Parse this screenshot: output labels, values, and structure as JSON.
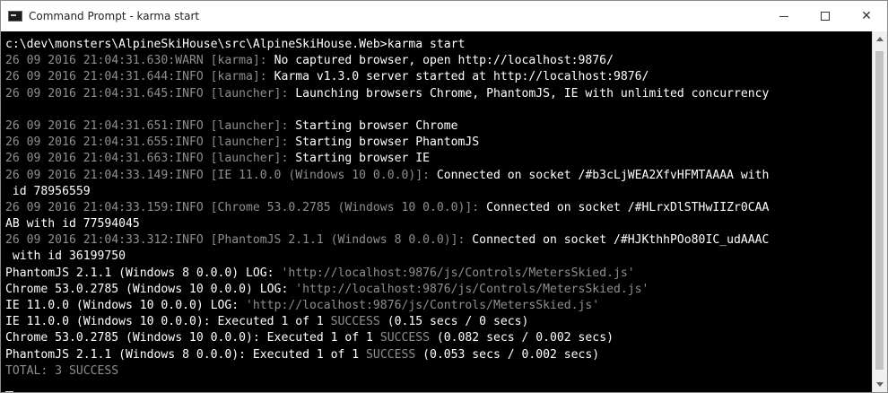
{
  "window": {
    "title": "Command Prompt - karma  start",
    "minimize_glyph": "—",
    "close_glyph": "✕"
  },
  "console": {
    "lines": [
      [
        {
          "t": "c:\\dev\\monsters\\AlpineSkiHouse\\src\\AlpineSkiHouse.Web>karma start",
          "c": "bright"
        }
      ],
      [
        {
          "t": "26 09 2016 21:04:31.630:WARN [karma]: ",
          "c": "dim"
        },
        {
          "t": "No captured browser, open http://localhost:9876/",
          "c": "bright"
        }
      ],
      [
        {
          "t": "26 09 2016 21:04:31.644:INFO [karma]: ",
          "c": "dim"
        },
        {
          "t": "Karma v1.3.0 server started at http://localhost:9876/",
          "c": "bright"
        }
      ],
      [
        {
          "t": "26 09 2016 21:04:31.645:INFO [launcher]: ",
          "c": "dim"
        },
        {
          "t": "Launching browsers Chrome, PhantomJS, IE with unlimited concurrency",
          "c": "bright"
        }
      ],
      [],
      [
        {
          "t": "26 09 2016 21:04:31.651:INFO [launcher]: ",
          "c": "dim"
        },
        {
          "t": "Starting browser Chrome",
          "c": "bright"
        }
      ],
      [
        {
          "t": "26 09 2016 21:04:31.655:INFO [launcher]: ",
          "c": "dim"
        },
        {
          "t": "Starting browser PhantomJS",
          "c": "bright"
        }
      ],
      [
        {
          "t": "26 09 2016 21:04:31.663:INFO [launcher]: ",
          "c": "dim"
        },
        {
          "t": "Starting browser IE",
          "c": "bright"
        }
      ],
      [
        {
          "t": "26 09 2016 21:04:33.149:INFO [IE 11.0.0 (Windows 10 0.0.0)]: ",
          "c": "dim"
        },
        {
          "t": "Connected on socket /#b3cLjWEA2XfvHFMTAAAA with",
          "c": "bright"
        }
      ],
      [
        {
          "t": " id 78956559",
          "c": "bright"
        }
      ],
      [
        {
          "t": "26 09 2016 21:04:33.159:INFO [Chrome 53.0.2785 (Windows 10 0.0.0)]: ",
          "c": "dim"
        },
        {
          "t": "Connected on socket /#HLrxDlSTHwIIZr0CAA",
          "c": "bright"
        }
      ],
      [
        {
          "t": "AB with id 77594045",
          "c": "bright"
        }
      ],
      [
        {
          "t": "26 09 2016 21:04:33.312:INFO [PhantomJS 2.1.1 (Windows 8 0.0.0)]: ",
          "c": "dim"
        },
        {
          "t": "Connected on socket /#HJKthhPOo80IC_udAAAC",
          "c": "bright"
        }
      ],
      [
        {
          "t": " with id 36199750",
          "c": "bright"
        }
      ],
      [
        {
          "t": "PhantomJS 2.1.1 (Windows 8 0.0.0) LOG: ",
          "c": "bright"
        },
        {
          "t": "'http://localhost:9876/js/Controls/MetersSkied.js'",
          "c": "dim"
        }
      ],
      [
        {
          "t": "Chrome 53.0.2785 (Windows 10 0.0.0) LOG: ",
          "c": "bright"
        },
        {
          "t": "'http://localhost:9876/js/Controls/MetersSkied.js'",
          "c": "dim"
        }
      ],
      [
        {
          "t": "IE 11.0.0 (Windows 10 0.0.0) LOG: ",
          "c": "bright"
        },
        {
          "t": "'http://localhost:9876/js/Controls/MetersSkied.js'",
          "c": "dim"
        }
      ],
      [
        {
          "t": "IE 11.0.0 (Windows 10 0.0.0): Executed 1 of 1 ",
          "c": "bright"
        },
        {
          "t": "SUCCESS",
          "c": "dim"
        },
        {
          "t": " (0.15 secs / 0 secs)",
          "c": "bright"
        }
      ],
      [
        {
          "t": "Chrome 53.0.2785 (Windows 10 0.0.0): Executed 1 of 1 ",
          "c": "bright"
        },
        {
          "t": "SUCCESS",
          "c": "dim"
        },
        {
          "t": " (0.082 secs / 0.002 secs)",
          "c": "bright"
        }
      ],
      [
        {
          "t": "PhantomJS 2.1.1 (Windows 8 0.0.0): Executed 1 of 1 ",
          "c": "bright"
        },
        {
          "t": "SUCCESS",
          "c": "dim"
        },
        {
          "t": " (0.053 secs / 0.002 secs)",
          "c": "bright"
        }
      ],
      [
        {
          "t": "TOTAL: 3 SUCCESS",
          "c": "dim"
        }
      ],
      []
    ]
  },
  "colors": {
    "background": "#000000",
    "text_bright": "#ffffff",
    "text_dim": "#8f8f8f",
    "titlebar": "#ffffff"
  },
  "icons": [
    "cmd-app-icon",
    "minimize-icon",
    "maximize-icon",
    "close-icon",
    "scroll-up-icon",
    "scroll-down-icon"
  ]
}
